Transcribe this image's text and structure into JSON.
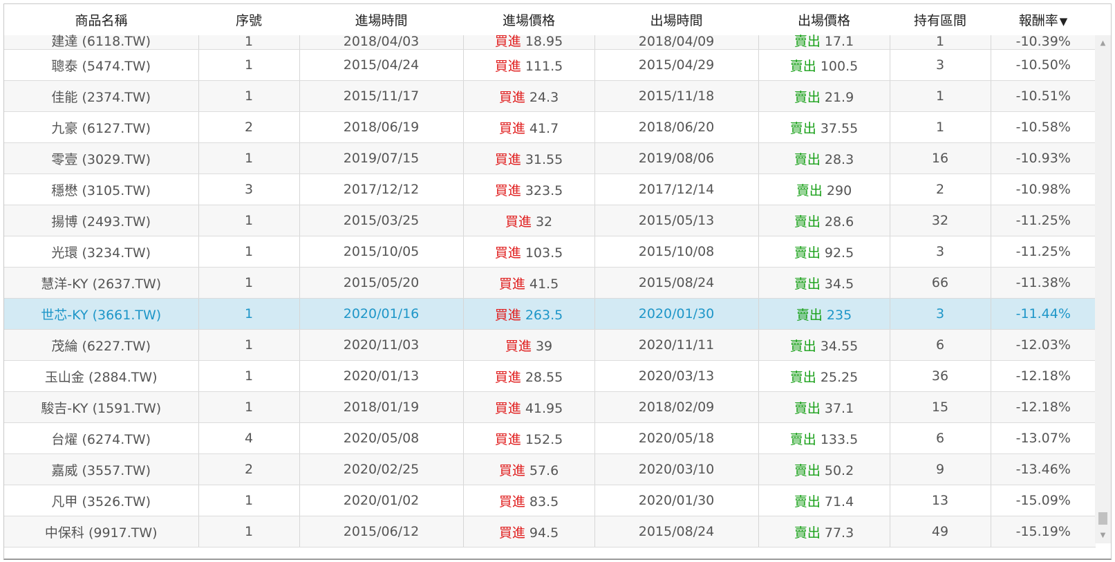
{
  "columns": [
    "商品名稱",
    "序號",
    "進場時間",
    "進場價格",
    "出場時間",
    "出場價格",
    "持有區間",
    "報酬率"
  ],
  "sort_indicator": "▼",
  "buy_label": "買進",
  "sell_label": "賣出",
  "rows": [
    {
      "name": "建達 (6118.TW)",
      "seq": "1",
      "entry_date": "2018/04/03",
      "entry_price": "18.95",
      "exit_date": "2018/04/09",
      "exit_price": "17.1",
      "hold": "1",
      "ret": "-10.39%"
    },
    {
      "name": "聰泰 (5474.TW)",
      "seq": "1",
      "entry_date": "2015/04/24",
      "entry_price": "111.5",
      "exit_date": "2015/04/29",
      "exit_price": "100.5",
      "hold": "3",
      "ret": "-10.50%"
    },
    {
      "name": "佳能 (2374.TW)",
      "seq": "1",
      "entry_date": "2015/11/17",
      "entry_price": "24.3",
      "exit_date": "2015/11/18",
      "exit_price": "21.9",
      "hold": "1",
      "ret": "-10.51%"
    },
    {
      "name": "九豪 (6127.TW)",
      "seq": "2",
      "entry_date": "2018/06/19",
      "entry_price": "41.7",
      "exit_date": "2018/06/20",
      "exit_price": "37.55",
      "hold": "1",
      "ret": "-10.58%"
    },
    {
      "name": "零壹 (3029.TW)",
      "seq": "1",
      "entry_date": "2019/07/15",
      "entry_price": "31.55",
      "exit_date": "2019/08/06",
      "exit_price": "28.3",
      "hold": "16",
      "ret": "-10.93%"
    },
    {
      "name": "穩懋 (3105.TW)",
      "seq": "3",
      "entry_date": "2017/12/12",
      "entry_price": "323.5",
      "exit_date": "2017/12/14",
      "exit_price": "290",
      "hold": "2",
      "ret": "-10.98%"
    },
    {
      "name": "揚博 (2493.TW)",
      "seq": "1",
      "entry_date": "2015/03/25",
      "entry_price": "32",
      "exit_date": "2015/05/13",
      "exit_price": "28.6",
      "hold": "32",
      "ret": "-11.25%"
    },
    {
      "name": "光環 (3234.TW)",
      "seq": "1",
      "entry_date": "2015/10/05",
      "entry_price": "103.5",
      "exit_date": "2015/10/08",
      "exit_price": "92.5",
      "hold": "3",
      "ret": "-11.25%"
    },
    {
      "name": "慧洋-KY (2637.TW)",
      "seq": "1",
      "entry_date": "2015/05/20",
      "entry_price": "41.5",
      "exit_date": "2015/08/24",
      "exit_price": "34.5",
      "hold": "66",
      "ret": "-11.38%"
    },
    {
      "name": "世芯-KY (3661.TW)",
      "seq": "1",
      "entry_date": "2020/01/16",
      "entry_price": "263.5",
      "exit_date": "2020/01/30",
      "exit_price": "235",
      "hold": "3",
      "ret": "-11.44%"
    },
    {
      "name": "茂綸 (6227.TW)",
      "seq": "1",
      "entry_date": "2020/11/03",
      "entry_price": "39",
      "exit_date": "2020/11/11",
      "exit_price": "34.55",
      "hold": "6",
      "ret": "-12.03%"
    },
    {
      "name": "玉山金 (2884.TW)",
      "seq": "1",
      "entry_date": "2020/01/13",
      "entry_price": "28.55",
      "exit_date": "2020/03/13",
      "exit_price": "25.25",
      "hold": "36",
      "ret": "-12.18%"
    },
    {
      "name": "駿吉-KY (1591.TW)",
      "seq": "1",
      "entry_date": "2018/01/19",
      "entry_price": "41.95",
      "exit_date": "2018/02/09",
      "exit_price": "37.1",
      "hold": "15",
      "ret": "-12.18%"
    },
    {
      "name": "台燿 (6274.TW)",
      "seq": "4",
      "entry_date": "2020/05/08",
      "entry_price": "152.5",
      "exit_date": "2020/05/18",
      "exit_price": "133.5",
      "hold": "6",
      "ret": "-13.07%"
    },
    {
      "name": "嘉威 (3557.TW)",
      "seq": "2",
      "entry_date": "2020/02/25",
      "entry_price": "57.6",
      "exit_date": "2020/03/10",
      "exit_price": "50.2",
      "hold": "9",
      "ret": "-13.46%"
    },
    {
      "name": "凡甲 (3526.TW)",
      "seq": "1",
      "entry_date": "2020/01/02",
      "entry_price": "83.5",
      "exit_date": "2020/01/30",
      "exit_price": "71.4",
      "hold": "13",
      "ret": "-15.09%"
    },
    {
      "name": "中保科 (9917.TW)",
      "seq": "1",
      "entry_date": "2015/06/12",
      "entry_price": "94.5",
      "exit_date": "2015/08/24",
      "exit_price": "77.3",
      "hold": "49",
      "ret": "-15.19%"
    }
  ],
  "highlight_index": 9,
  "scroll_up_glyph": "▲",
  "scroll_down_glyph": "▼"
}
